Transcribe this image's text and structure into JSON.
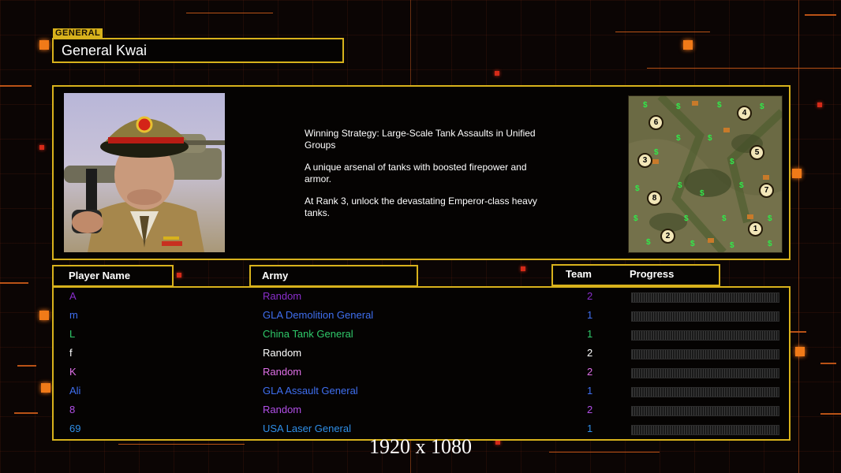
{
  "header": {
    "section_tag": "GENERAL",
    "title": "General Kwai"
  },
  "general": {
    "description": [
      "Winning Strategy: Large-Scale Tank Assaults in Unified\n Groups",
      "A unique arsenal of tanks with boosted firepower and\n armor.",
      "At Rank 3, unlock the devastating Emperor-class heavy\n tanks."
    ]
  },
  "minimap": {
    "markers": [
      "6",
      "4",
      "3",
      "5",
      "8",
      "7",
      "2",
      "1"
    ]
  },
  "columns": {
    "player_name": "Player Name",
    "army": "Army",
    "team": "Team",
    "progress": "Progress"
  },
  "players": [
    {
      "name": "A",
      "army": "Random",
      "team": "2",
      "color": "#8a2ecc"
    },
    {
      "name": "m",
      "army": "GLA Demolition General",
      "team": "1",
      "color": "#3f6ff0"
    },
    {
      "name": "L",
      "army": "China Tank General",
      "team": "1",
      "color": "#2fc96a"
    },
    {
      "name": "f",
      "army": "Random",
      "team": "2",
      "color": "#ffffff"
    },
    {
      "name": "K",
      "army": "Random",
      "team": "2",
      "color": "#e070e8"
    },
    {
      "name": "Ali",
      "army": "GLA Assault General",
      "team": "1",
      "color": "#3f6ff0"
    },
    {
      "name": "8",
      "army": "Random",
      "team": "2",
      "color": "#b24fe8"
    },
    {
      "name": "69",
      "army": "USA Laser General",
      "team": "1",
      "color": "#2f8fe8"
    }
  ],
  "footer": {
    "resolution": "1920 x 1080"
  },
  "colors": {
    "accent_gold": "#d8b21c",
    "accent_orange": "#f07a18",
    "money_green": "#31e84a"
  }
}
